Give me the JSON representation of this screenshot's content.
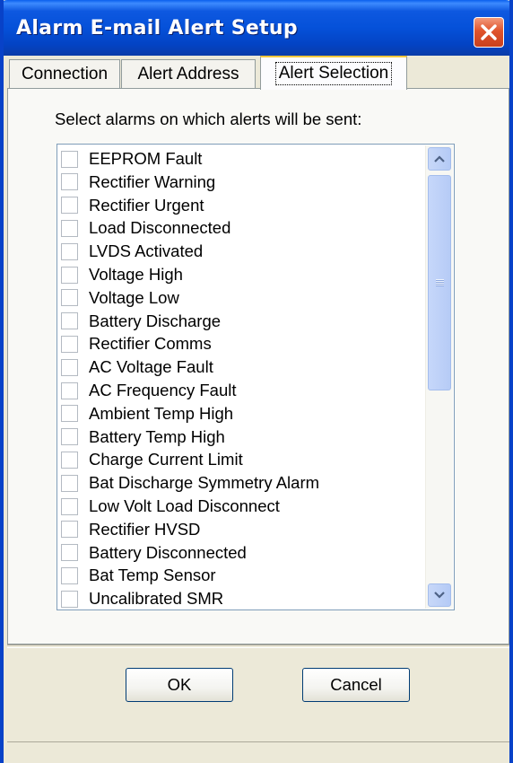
{
  "window": {
    "title": "Alarm E-mail Alert Setup",
    "title_bar_color": "#0551D9",
    "close_icon": "close-x-icon"
  },
  "tabs": [
    {
      "label": "Connection",
      "active": false
    },
    {
      "label": "Alert Address",
      "active": false
    },
    {
      "label": "Alert Selection",
      "active": true
    }
  ],
  "panel": {
    "instruction": "Select alarms on which alerts will be sent:"
  },
  "alarms": [
    {
      "label": "EEPROM Fault",
      "checked": false
    },
    {
      "label": "Rectifier Warning",
      "checked": false
    },
    {
      "label": "Rectifier Urgent",
      "checked": false
    },
    {
      "label": "Load Disconnected",
      "checked": false
    },
    {
      "label": "LVDS Activated",
      "checked": false
    },
    {
      "label": "Voltage High",
      "checked": false
    },
    {
      "label": "Voltage Low",
      "checked": false
    },
    {
      "label": "Battery Discharge",
      "checked": false
    },
    {
      "label": "Rectifier Comms",
      "checked": false
    },
    {
      "label": "AC Voltage Fault",
      "checked": false
    },
    {
      "label": "AC Frequency Fault",
      "checked": false
    },
    {
      "label": "Ambient Temp High",
      "checked": false
    },
    {
      "label": "Battery Temp High",
      "checked": false
    },
    {
      "label": "Charge Current Limit",
      "checked": false
    },
    {
      "label": "Bat Discharge Symmetry Alarm",
      "checked": false
    },
    {
      "label": "Low Volt Load Disconnect",
      "checked": false
    },
    {
      "label": "Rectifier HVSD",
      "checked": false
    },
    {
      "label": "Battery Disconnected",
      "checked": false
    },
    {
      "label": "Bat Temp Sensor",
      "checked": false
    },
    {
      "label": "Uncalibrated SMR",
      "checked": false
    }
  ],
  "scrollbar": {
    "up_icon": "chevron-up-icon",
    "down_icon": "chevron-down-icon",
    "position": 0
  },
  "buttons": {
    "ok_label": "OK",
    "cancel_label": "Cancel"
  }
}
